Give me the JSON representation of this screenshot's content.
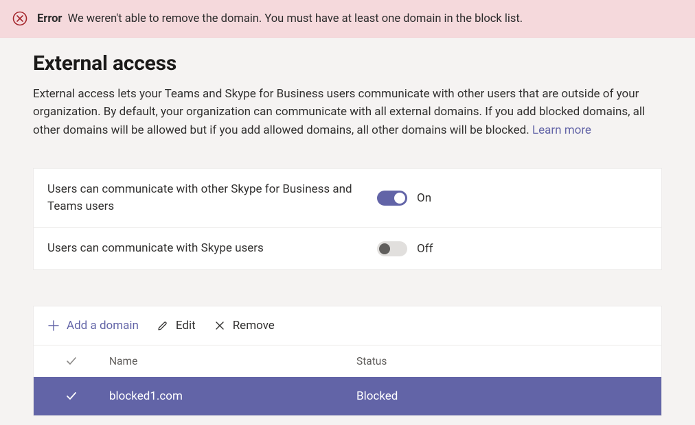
{
  "error": {
    "title": "Error",
    "message": "We weren't able to remove the domain. You must have at least one domain in the block list."
  },
  "page": {
    "title": "External access",
    "description": "External access lets your Teams and Skype for Business users communicate with other users that are outside of your organization. By default, your organization can communicate with all external domains. If you add blocked domains, all other domains will be allowed but if you add allowed domains, all other domains will be blocked.",
    "learn_more": "Learn more"
  },
  "settings": [
    {
      "label": "Users can communicate with other Skype for Business and Teams users",
      "on": true,
      "state": "On"
    },
    {
      "label": "Users can communicate with Skype users",
      "on": false,
      "state": "Off"
    }
  ],
  "toolbar": {
    "add": "Add a domain",
    "edit": "Edit",
    "remove": "Remove"
  },
  "table": {
    "headers": {
      "name": "Name",
      "status": "Status"
    },
    "rows": [
      {
        "name": "blocked1.com",
        "status": "Blocked",
        "selected": true
      }
    ]
  }
}
